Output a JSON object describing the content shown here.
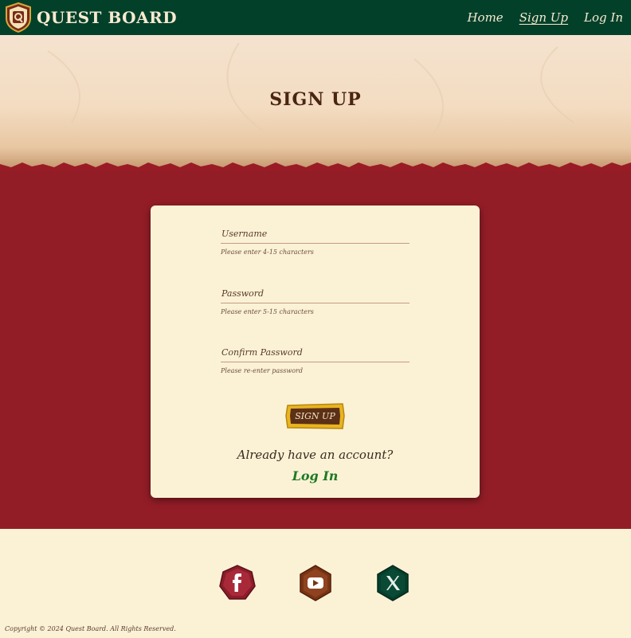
{
  "header": {
    "brand": "QUEST BOARD",
    "nav": [
      {
        "label": "Home",
        "active": false
      },
      {
        "label": "Sign Up",
        "active": true
      },
      {
        "label": "Log In",
        "active": false
      }
    ]
  },
  "banner": {
    "title": "SIGN UP"
  },
  "form": {
    "fields": [
      {
        "label": "Username",
        "hint": "Please enter 4-15 characters"
      },
      {
        "label": "Password",
        "hint": "Please enter 5-15 characters"
      },
      {
        "label": "Confirm Password",
        "hint": "Please re-enter password"
      }
    ],
    "submit_label": "SIGN UP",
    "already_text": "Already have an account?",
    "login_label": "Log In"
  },
  "footer": {
    "social": [
      {
        "icon": "facebook-icon",
        "color": "#8b1d2a"
      },
      {
        "icon": "youtube-icon",
        "color": "#7a3313"
      },
      {
        "icon": "x-icon",
        "color": "#063f2c"
      }
    ],
    "copyright": "Copyright © 2024 Quest Board. All Rights Reserved."
  },
  "colors": {
    "nav_bg": "#03402a",
    "accent_red": "#931d27",
    "parchment": "#fbf2d6",
    "link_green": "#1f7a22"
  }
}
